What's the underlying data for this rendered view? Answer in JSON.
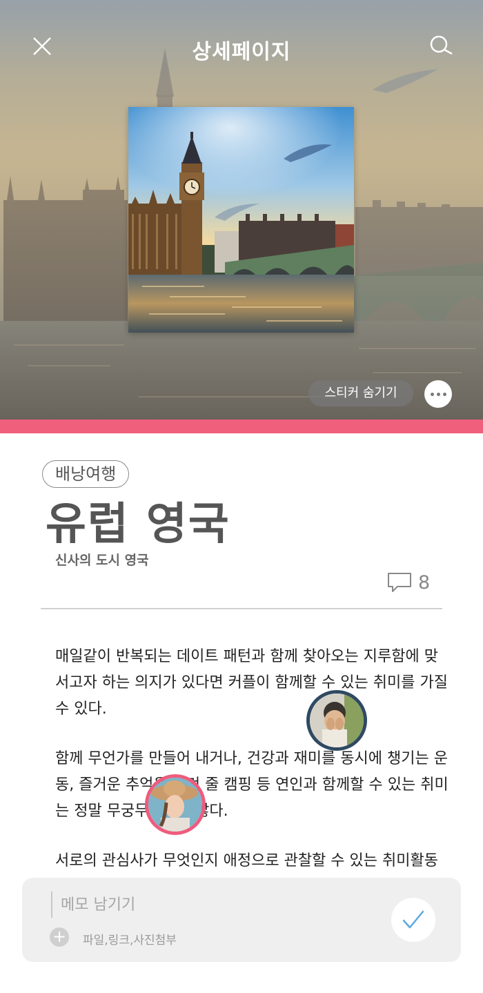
{
  "header": {
    "title": "상세페이지",
    "close_icon": "close-icon",
    "search_icon": "search-icon"
  },
  "hero": {
    "sticker_button_label": "스티커 숨기기",
    "more_icon": "more-horizontal-icon",
    "accent_color": "#f0607d"
  },
  "post": {
    "tag": "배낭여행",
    "title": "유럽 영국",
    "subtitle": "신사의 도시 영국",
    "comment_icon": "comment-icon",
    "comment_count": "8",
    "paragraphs": [
      "매일같이 반복되는 데이트 패턴과 함께 찾아오는 지루함에 맞서고자 하는 의지가 있다면 커플이 함께할 수 있는 취미를 가질 수 있다.",
      "함께 무언가를 만들어 내거나, 건강과 재미를 동시에 챙기는 운동, 즐거운 추억을 남겨 줄 캠핑 등 연인과 함께할 수 있는 취미는 정말 무궁무진하게 많다.",
      "서로의 관심사가 무엇인지 애정으로 관찰할 수 있는 취미활동"
    ]
  },
  "memo": {
    "placeholder": "메모 남기기",
    "attach_label": "파일,링크,사진첨부",
    "submit_icon": "check-icon",
    "check_color": "#5aa8e0"
  }
}
